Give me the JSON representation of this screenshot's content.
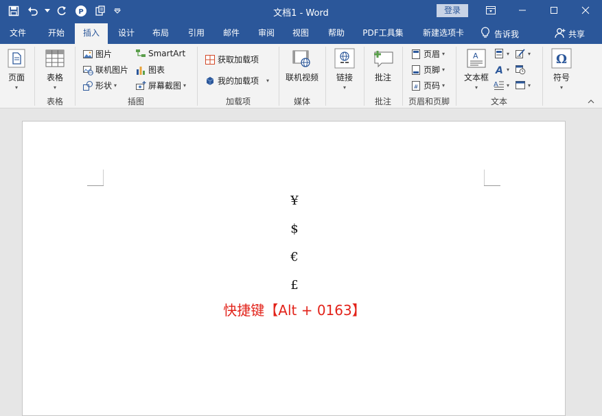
{
  "window": {
    "title": "文档1  -  Word",
    "login_label": "登录"
  },
  "tabs": [
    {
      "label": "文件"
    },
    {
      "label": "开始"
    },
    {
      "label": "插入"
    },
    {
      "label": "设计"
    },
    {
      "label": "布局"
    },
    {
      "label": "引用"
    },
    {
      "label": "邮件"
    },
    {
      "label": "审阅"
    },
    {
      "label": "视图"
    },
    {
      "label": "帮助"
    },
    {
      "label": "PDF工具集"
    },
    {
      "label": "新建选项卡"
    }
  ],
  "tell_me": "告诉我",
  "share": "共享",
  "ribbon": {
    "pages": {
      "button": "页面",
      "group": ""
    },
    "tables": {
      "button": "表格",
      "group": "表格"
    },
    "illustrations": {
      "picture": "图片",
      "online_picture": "联机图片",
      "shapes": "形状",
      "smartart": "SmartArt",
      "chart": "图表",
      "screenshot": "屏幕截图",
      "group": "插图"
    },
    "addins": {
      "get": "获取加载项",
      "mine": "我的加载项",
      "group": "加载项"
    },
    "media": {
      "video": "联机视频",
      "group": "媒体"
    },
    "links": {
      "link": "链接",
      "group": ""
    },
    "comments": {
      "comment": "批注",
      "group": "批注"
    },
    "header_footer": {
      "header": "页眉",
      "footer": "页脚",
      "page_number": "页码",
      "group": "页眉和页脚"
    },
    "text": {
      "textbox": "文本框",
      "group": "文本"
    },
    "symbols": {
      "symbol": "符号"
    }
  },
  "document": {
    "symbols": [
      "¥",
      "$",
      "€",
      "£"
    ],
    "hint": "快捷键【Alt + 0163】"
  },
  "colors": {
    "brand": "#2b579a",
    "hint_red": "#e2231a"
  }
}
